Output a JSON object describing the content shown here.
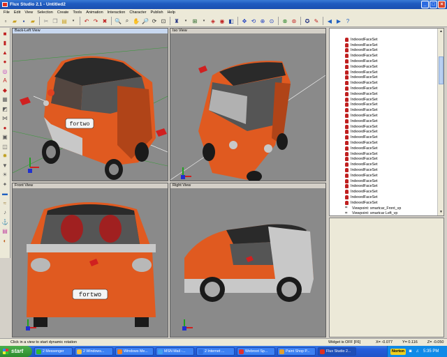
{
  "window": {
    "title": "Flux Studio 2.1 - Untitled2"
  },
  "menubar": {
    "items": [
      "File",
      "Edit",
      "View",
      "Selection",
      "Create",
      "Tools",
      "Animation",
      "Interaction",
      "Character",
      "Publish",
      "Help"
    ]
  },
  "viewports": {
    "back_left": {
      "label": "Back-Left View"
    },
    "iso": {
      "label": "Iso View"
    },
    "front": {
      "label": "Front View"
    },
    "right": {
      "label": "Right View"
    }
  },
  "car": {
    "plate_text": "fortwo",
    "body_color": "#e05a20",
    "roof_color": "#2a2a2a",
    "trim_color": "#b8b8b8"
  },
  "scene_graph": {
    "items": [
      "IndexedFaceSet",
      "IndexedFaceSet",
      "IndexedFaceSet",
      "IndexedFaceSet",
      "IndexedFaceSet",
      "IndexedFaceSet",
      "IndexedFaceSet",
      "IndexedFaceSet",
      "IndexedFaceSet",
      "IndexedFaceSet",
      "IndexedFaceSet",
      "IndexedFaceSet",
      "IndexedFaceSet",
      "IndexedFaceSet",
      "IndexedFaceSet",
      "IndexedFaceSet",
      "IndexedFaceSet",
      "IndexedFaceSet",
      "IndexedFaceSet",
      "IndexedFaceSet",
      "IndexedFaceSet",
      "IndexedFaceSet",
      "IndexedFaceSet",
      "IndexedFaceSet",
      "IndexedFaceSet",
      "IndexedFaceSet",
      "IndexedFaceSet",
      "IndexedFaceSet",
      "IndexedFaceSet",
      "IndexedFaceSet",
      "IndexedFaceSet"
    ],
    "viewpoints": [
      "Viewpoint: smartcar_Front_vp",
      "Viewpoint: smartcar Left_vp"
    ]
  },
  "statusbar": {
    "message": "Click in a view to start dynamic rotation",
    "widget": "Widget is OFF [F6]",
    "x": "X= -0.077",
    "y": "Y= 0.116",
    "z": "Z= -0.050"
  },
  "taskbar": {
    "start_label": "start",
    "items": [
      "2 Messenger",
      "2 Windows...",
      "Windows Me...",
      "MSN Mail -...",
      "2 Internet ...",
      "Webroot Sp...",
      "Paint Shop P...",
      "Flux Studio 2..."
    ],
    "norton": "Norton",
    "clock": "5:35 PM"
  }
}
